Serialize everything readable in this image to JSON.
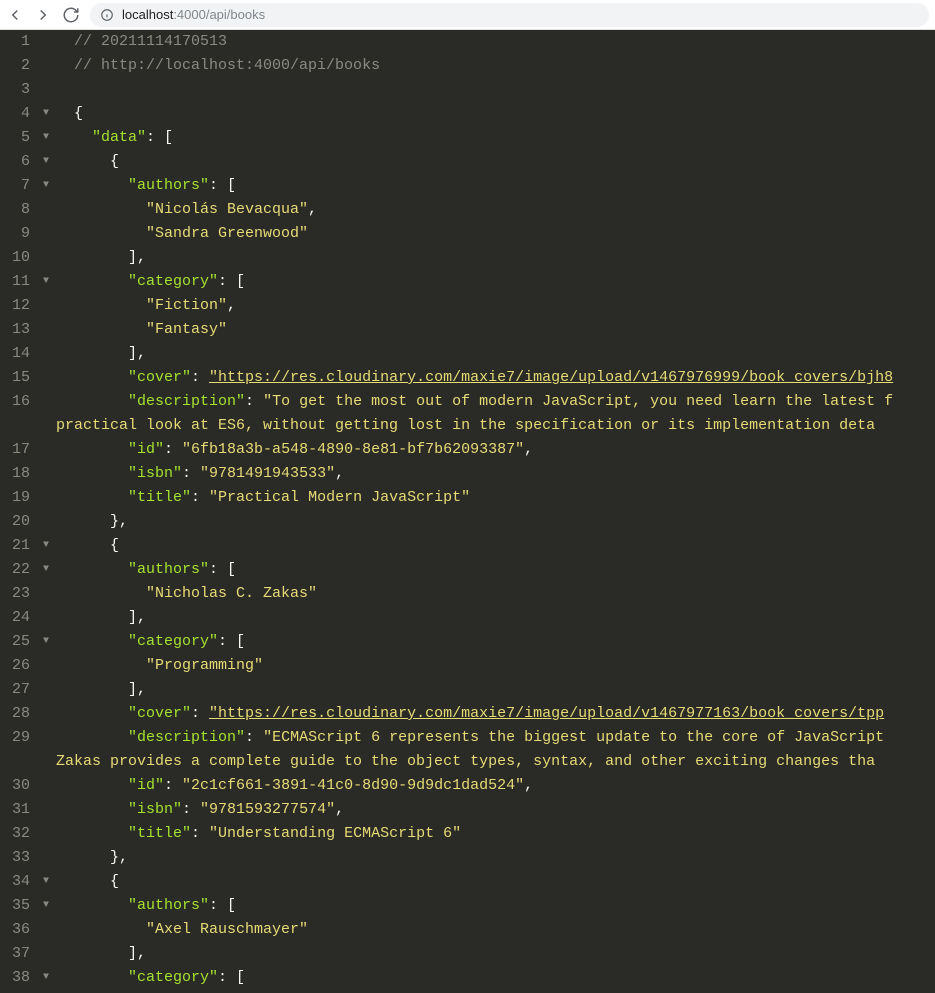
{
  "url_host": "localhost",
  "url_port_path": ":4000/api/books",
  "lines": [
    {
      "n": 1,
      "fold": "",
      "tokens": [
        [
          "sp",
          "  "
        ],
        [
          "com",
          "// 20211114170513"
        ]
      ]
    },
    {
      "n": 2,
      "fold": "",
      "tokens": [
        [
          "sp",
          "  "
        ],
        [
          "com",
          "// http://localhost:4000/api/books"
        ]
      ]
    },
    {
      "n": 3,
      "fold": "",
      "tokens": []
    },
    {
      "n": 4,
      "fold": "▼",
      "tokens": [
        [
          "sp",
          "  "
        ],
        [
          "p",
          "{"
        ]
      ]
    },
    {
      "n": 5,
      "fold": "▼",
      "tokens": [
        [
          "sp",
          "    "
        ],
        [
          "k",
          "\"data\""
        ],
        [
          "p",
          ": ["
        ]
      ]
    },
    {
      "n": 6,
      "fold": "▼",
      "tokens": [
        [
          "sp",
          "      "
        ],
        [
          "p",
          "{"
        ]
      ]
    },
    {
      "n": 7,
      "fold": "▼",
      "tokens": [
        [
          "sp",
          "        "
        ],
        [
          "k",
          "\"authors\""
        ],
        [
          "p",
          ": ["
        ]
      ]
    },
    {
      "n": 8,
      "fold": "",
      "tokens": [
        [
          "sp",
          "          "
        ],
        [
          "s",
          "\"Nicolás Bevacqua\""
        ],
        [
          "p",
          ","
        ]
      ]
    },
    {
      "n": 9,
      "fold": "",
      "tokens": [
        [
          "sp",
          "          "
        ],
        [
          "s",
          "\"Sandra Greenwood\""
        ]
      ]
    },
    {
      "n": 10,
      "fold": "",
      "tokens": [
        [
          "sp",
          "        "
        ],
        [
          "p",
          "],"
        ]
      ]
    },
    {
      "n": 11,
      "fold": "▼",
      "tokens": [
        [
          "sp",
          "        "
        ],
        [
          "k",
          "\"category\""
        ],
        [
          "p",
          ": ["
        ]
      ]
    },
    {
      "n": 12,
      "fold": "",
      "tokens": [
        [
          "sp",
          "          "
        ],
        [
          "s",
          "\"Fiction\""
        ],
        [
          "p",
          ","
        ]
      ]
    },
    {
      "n": 13,
      "fold": "",
      "tokens": [
        [
          "sp",
          "          "
        ],
        [
          "s",
          "\"Fantasy\""
        ]
      ]
    },
    {
      "n": 14,
      "fold": "",
      "tokens": [
        [
          "sp",
          "        "
        ],
        [
          "p",
          "],"
        ]
      ]
    },
    {
      "n": 15,
      "fold": "",
      "tokens": [
        [
          "sp",
          "        "
        ],
        [
          "k",
          "\"cover\""
        ],
        [
          "p",
          ": "
        ],
        [
          "l",
          "\"https://res.cloudinary.com/maxie7/image/upload/v1467976999/book_covers/bjh8"
        ]
      ]
    },
    {
      "n": 16,
      "fold": "",
      "tokens": [
        [
          "sp",
          "        "
        ],
        [
          "k",
          "\"description\""
        ],
        [
          "p",
          ": "
        ],
        [
          "s",
          "\"To get the most out of modern JavaScript, you need learn the latest f"
        ]
      ]
    },
    {
      "n": 0,
      "fold": "",
      "wrap": true,
      "tokens": [
        [
          "s",
          "practical look at ES6, without getting lost in the specification or its implementation deta"
        ]
      ]
    },
    {
      "n": 17,
      "fold": "",
      "tokens": [
        [
          "sp",
          "        "
        ],
        [
          "k",
          "\"id\""
        ],
        [
          "p",
          ": "
        ],
        [
          "s",
          "\"6fb18a3b-a548-4890-8e81-bf7b62093387\""
        ],
        [
          "p",
          ","
        ]
      ]
    },
    {
      "n": 18,
      "fold": "",
      "tokens": [
        [
          "sp",
          "        "
        ],
        [
          "k",
          "\"isbn\""
        ],
        [
          "p",
          ": "
        ],
        [
          "s",
          "\"9781491943533\""
        ],
        [
          "p",
          ","
        ]
      ]
    },
    {
      "n": 19,
      "fold": "",
      "tokens": [
        [
          "sp",
          "        "
        ],
        [
          "k",
          "\"title\""
        ],
        [
          "p",
          ": "
        ],
        [
          "s",
          "\"Practical Modern JavaScript\""
        ]
      ]
    },
    {
      "n": 20,
      "fold": "",
      "tokens": [
        [
          "sp",
          "      "
        ],
        [
          "p",
          "},"
        ]
      ]
    },
    {
      "n": 21,
      "fold": "▼",
      "tokens": [
        [
          "sp",
          "      "
        ],
        [
          "p",
          "{"
        ]
      ]
    },
    {
      "n": 22,
      "fold": "▼",
      "tokens": [
        [
          "sp",
          "        "
        ],
        [
          "k",
          "\"authors\""
        ],
        [
          "p",
          ": ["
        ]
      ]
    },
    {
      "n": 23,
      "fold": "",
      "tokens": [
        [
          "sp",
          "          "
        ],
        [
          "s",
          "\"Nicholas C. Zakas\""
        ]
      ]
    },
    {
      "n": 24,
      "fold": "",
      "tokens": [
        [
          "sp",
          "        "
        ],
        [
          "p",
          "],"
        ]
      ]
    },
    {
      "n": 25,
      "fold": "▼",
      "tokens": [
        [
          "sp",
          "        "
        ],
        [
          "k",
          "\"category\""
        ],
        [
          "p",
          ": ["
        ]
      ]
    },
    {
      "n": 26,
      "fold": "",
      "tokens": [
        [
          "sp",
          "          "
        ],
        [
          "s",
          "\"Programming\""
        ]
      ]
    },
    {
      "n": 27,
      "fold": "",
      "tokens": [
        [
          "sp",
          "        "
        ],
        [
          "p",
          "],"
        ]
      ]
    },
    {
      "n": 28,
      "fold": "",
      "tokens": [
        [
          "sp",
          "        "
        ],
        [
          "k",
          "\"cover\""
        ],
        [
          "p",
          ": "
        ],
        [
          "l",
          "\"https://res.cloudinary.com/maxie7/image/upload/v1467977163/book_covers/tpp"
        ]
      ]
    },
    {
      "n": 29,
      "fold": "",
      "tokens": [
        [
          "sp",
          "        "
        ],
        [
          "k",
          "\"description\""
        ],
        [
          "p",
          ": "
        ],
        [
          "s",
          "\"ECMAScript 6 represents the biggest update to the core of JavaScript "
        ]
      ]
    },
    {
      "n": 0,
      "fold": "",
      "wrap": true,
      "tokens": [
        [
          "s",
          "Zakas provides a complete guide to the object types, syntax, and other exciting changes tha"
        ]
      ]
    },
    {
      "n": 30,
      "fold": "",
      "tokens": [
        [
          "sp",
          "        "
        ],
        [
          "k",
          "\"id\""
        ],
        [
          "p",
          ": "
        ],
        [
          "s",
          "\"2c1cf661-3891-41c0-8d90-9d9dc1dad524\""
        ],
        [
          "p",
          ","
        ]
      ]
    },
    {
      "n": 31,
      "fold": "",
      "tokens": [
        [
          "sp",
          "        "
        ],
        [
          "k",
          "\"isbn\""
        ],
        [
          "p",
          ": "
        ],
        [
          "s",
          "\"9781593277574\""
        ],
        [
          "p",
          ","
        ]
      ]
    },
    {
      "n": 32,
      "fold": "",
      "tokens": [
        [
          "sp",
          "        "
        ],
        [
          "k",
          "\"title\""
        ],
        [
          "p",
          ": "
        ],
        [
          "s",
          "\"Understanding ECMAScript 6\""
        ]
      ]
    },
    {
      "n": 33,
      "fold": "",
      "tokens": [
        [
          "sp",
          "      "
        ],
        [
          "p",
          "},"
        ]
      ]
    },
    {
      "n": 34,
      "fold": "▼",
      "tokens": [
        [
          "sp",
          "      "
        ],
        [
          "p",
          "{"
        ]
      ]
    },
    {
      "n": 35,
      "fold": "▼",
      "tokens": [
        [
          "sp",
          "        "
        ],
        [
          "k",
          "\"authors\""
        ],
        [
          "p",
          ": ["
        ]
      ]
    },
    {
      "n": 36,
      "fold": "",
      "tokens": [
        [
          "sp",
          "          "
        ],
        [
          "s",
          "\"Axel Rauschmayer\""
        ]
      ]
    },
    {
      "n": 37,
      "fold": "",
      "tokens": [
        [
          "sp",
          "        "
        ],
        [
          "p",
          "],"
        ]
      ]
    },
    {
      "n": 38,
      "fold": "▼",
      "tokens": [
        [
          "sp",
          "        "
        ],
        [
          "k",
          "\"category\""
        ],
        [
          "p",
          ": ["
        ]
      ]
    }
  ]
}
